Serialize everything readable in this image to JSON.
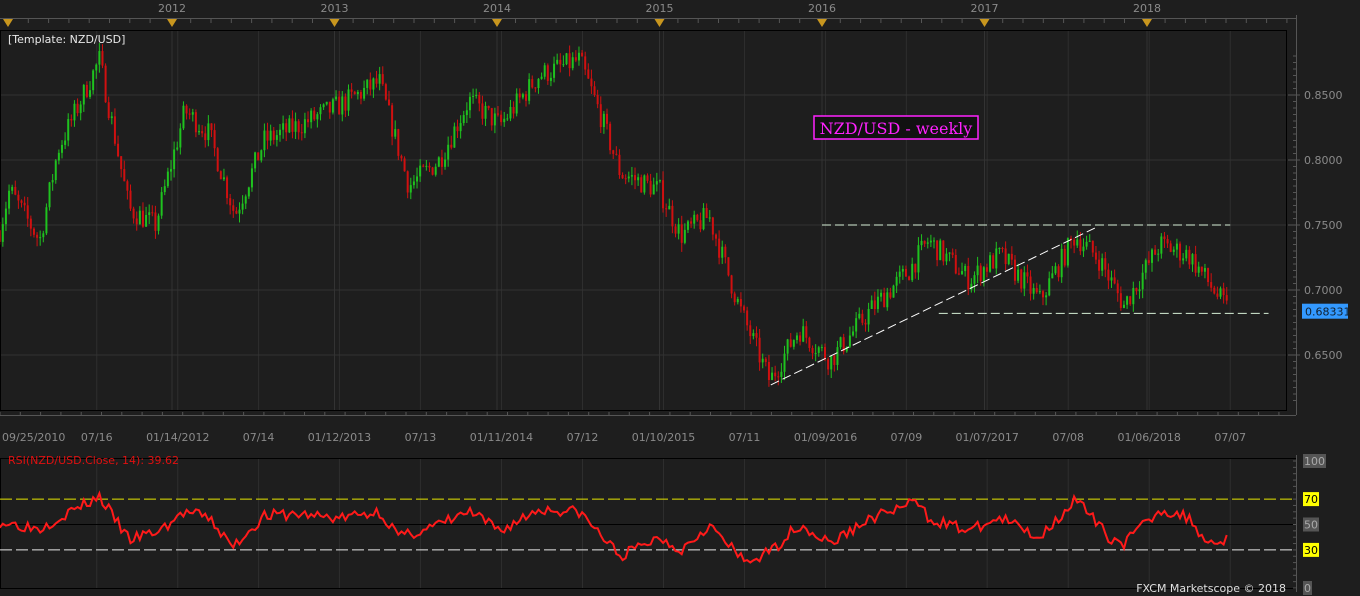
{
  "template_label": "[Template: NZD/USD]",
  "annotation": "NZD/USD - weekly",
  "footer": "FXCM Marketscope © 2018",
  "colors": {
    "background": "#1e1e1e",
    "up": "#1fc21f",
    "down": "#d01010",
    "rsi": "#ff1a1a",
    "levels": "#e6e600",
    "price_tag": "#3399ff",
    "annotation": "#ff22ff"
  },
  "chart_data": [
    {
      "type": "candlestick",
      "symbol": "NZD/USD",
      "timeframe": "weekly",
      "last_price": "0.68331",
      "ylim": [
        0.61,
        0.89
      ],
      "y_ticks": [
        "0.6500",
        "0.7000",
        "0.7500",
        "0.8000",
        "0.8500"
      ],
      "year_labels": [
        "2012",
        "2013",
        "2014",
        "2015",
        "2016",
        "2017",
        "2018"
      ],
      "x_ticks": [
        {
          "label": "09/25/2010",
          "date": "2010-09-25"
        },
        {
          "label": "07/16",
          "date": "2011-07-16"
        },
        {
          "label": "01/14/2012",
          "date": "2012-01-14"
        },
        {
          "label": "07/14",
          "date": "2012-07-14"
        },
        {
          "label": "01/12/2013",
          "date": "2013-01-12"
        },
        {
          "label": "07/13",
          "date": "2013-07-13"
        },
        {
          "label": "01/11/2014",
          "date": "2014-01-11"
        },
        {
          "label": "07/12",
          "date": "2014-07-12"
        },
        {
          "label": "01/10/2015",
          "date": "2015-01-10"
        },
        {
          "label": "07/11",
          "date": "2015-07-11"
        },
        {
          "label": "01/09/2016",
          "date": "2016-01-09"
        },
        {
          "label": "07/09",
          "date": "2016-07-09"
        },
        {
          "label": "01/07/2017",
          "date": "2017-01-07"
        },
        {
          "label": "07/08",
          "date": "2017-07-08"
        },
        {
          "label": "01/06/2018",
          "date": "2018-01-06"
        },
        {
          "label": "07/07",
          "date": "2018-07-07"
        }
      ],
      "close_path": [
        [
          "2010-12-10",
          0.746
        ],
        [
          "2011-01-01",
          0.777
        ],
        [
          "2011-03-10",
          0.738
        ],
        [
          "2011-04-20",
          0.808
        ],
        [
          "2011-07-22",
          0.877
        ],
        [
          "2011-09-27",
          0.762
        ],
        [
          "2011-11-25",
          0.75
        ],
        [
          "2012-01-30",
          0.838
        ],
        [
          "2012-03-25",
          0.82
        ],
        [
          "2012-05-22",
          0.758
        ],
        [
          "2012-07-27",
          0.815
        ],
        [
          "2012-10-15",
          0.827
        ],
        [
          "2013-01-12",
          0.842
        ],
        [
          "2013-04-12",
          0.86
        ],
        [
          "2013-06-17",
          0.78
        ],
        [
          "2013-08-25",
          0.8
        ],
        [
          "2013-10-30",
          0.846
        ],
        [
          "2014-01-08",
          0.827
        ],
        [
          "2014-04-05",
          0.865
        ],
        [
          "2014-07-05",
          0.877
        ],
        [
          "2014-08-18",
          0.838
        ],
        [
          "2014-10-05",
          0.79
        ],
        [
          "2015-01-01",
          0.777
        ],
        [
          "2015-02-18",
          0.742
        ],
        [
          "2015-04-22",
          0.757
        ],
        [
          "2015-07-01",
          0.685
        ],
        [
          "2015-09-06",
          0.63
        ],
        [
          "2015-11-10",
          0.67
        ],
        [
          "2016-01-20",
          0.646
        ],
        [
          "2016-04-20",
          0.685
        ],
        [
          "2016-07-15",
          0.715
        ],
        [
          "2016-08-28",
          0.738
        ],
        [
          "2016-11-28",
          0.708
        ],
        [
          "2017-02-06",
          0.727
        ],
        [
          "2017-05-05",
          0.692
        ],
        [
          "2017-07-24",
          0.742
        ],
        [
          "2017-09-17",
          0.723
        ],
        [
          "2017-11-10",
          0.688
        ],
        [
          "2018-01-30",
          0.735
        ],
        [
          "2018-04-05",
          0.727
        ],
        [
          "2018-07-05",
          0.683
        ]
      ],
      "lines": [
        {
          "kind": "horizontal-dashed",
          "price": 0.75,
          "from": "2016-01-01",
          "to": "2018-07-07",
          "color": "#d8f0d8"
        },
        {
          "kind": "horizontal-dashed",
          "price": 0.682,
          "from": "2016-09-20",
          "to": "2018-10-01",
          "color": "#d8f0d8"
        },
        {
          "kind": "trendline",
          "from": [
            "2015-09-08",
            0.627
          ],
          "to": [
            "2017-09-08",
            0.748
          ],
          "color": "#ffffff"
        }
      ]
    },
    {
      "type": "line",
      "title": "RSI(NZD/USD.Close, 14): 39.62",
      "ylim": [
        0,
        100
      ],
      "y_ticks": [
        "100",
        "70",
        "50",
        "30",
        "0"
      ],
      "levels": [
        70,
        30
      ],
      "values": [
        [
          "2010-12-10",
          52
        ],
        [
          "2011-03-10",
          47
        ],
        [
          "2011-04-20",
          55
        ],
        [
          "2011-07-22",
          72
        ],
        [
          "2011-09-27",
          38
        ],
        [
          "2011-12-05",
          45
        ],
        [
          "2012-01-30",
          60
        ],
        [
          "2012-03-25",
          55
        ],
        [
          "2012-05-16",
          32
        ],
        [
          "2012-07-27",
          57
        ],
        [
          "2012-10-15",
          58
        ],
        [
          "2013-01-12",
          55
        ],
        [
          "2013-04-12",
          60
        ],
        [
          "2013-05-28",
          40
        ],
        [
          "2013-08-25",
          50
        ],
        [
          "2013-10-30",
          60
        ],
        [
          "2014-01-08",
          45
        ],
        [
          "2014-04-05",
          62
        ],
        [
          "2014-07-05",
          60
        ],
        [
          "2014-10-05",
          25
        ],
        [
          "2015-01-01",
          40
        ],
        [
          "2015-02-18",
          30
        ],
        [
          "2015-04-22",
          50
        ],
        [
          "2015-07-12",
          20
        ],
        [
          "2015-09-06",
          28
        ],
        [
          "2015-11-10",
          50
        ],
        [
          "2016-01-20",
          35
        ],
        [
          "2016-04-20",
          55
        ],
        [
          "2016-08-02",
          68
        ],
        [
          "2016-08-28",
          55
        ],
        [
          "2016-11-28",
          45
        ],
        [
          "2017-02-06",
          55
        ],
        [
          "2017-05-05",
          40
        ],
        [
          "2017-07-24",
          70
        ],
        [
          "2017-10-08",
          40
        ],
        [
          "2017-11-10",
          35
        ],
        [
          "2018-01-30",
          62
        ],
        [
          "2018-04-05",
          55
        ],
        [
          "2018-05-20",
          35
        ],
        [
          "2018-07-05",
          40
        ]
      ]
    }
  ]
}
